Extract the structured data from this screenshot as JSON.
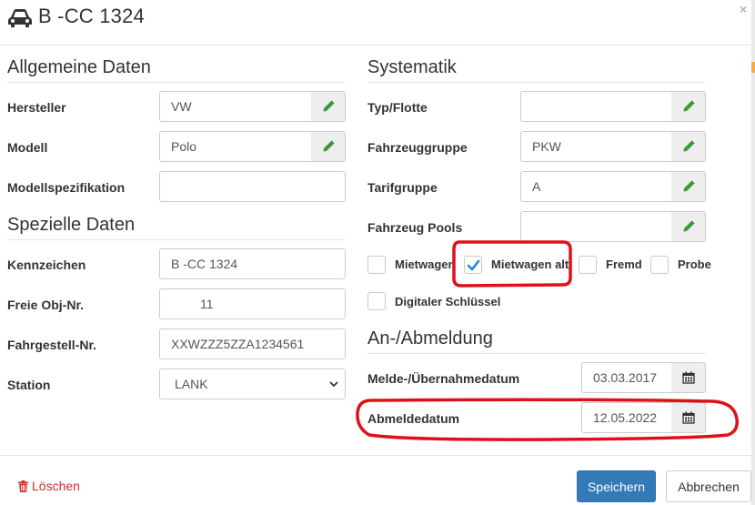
{
  "dialog": {
    "title": "B -CC 1324",
    "close_symbol": "×"
  },
  "general": {
    "title": "Allgemeine Daten",
    "manufacturer": {
      "label": "Hersteller",
      "value": "VW"
    },
    "model": {
      "label": "Modell",
      "value": "Polo"
    },
    "model_spec": {
      "label": "Modellspezifikation",
      "value": ""
    }
  },
  "special": {
    "title": "Spezielle Daten",
    "plate": {
      "label": "Kennzeichen",
      "value": "B  -CC 1324"
    },
    "free_obj": {
      "label": "Freie Obj-Nr.",
      "value": "11"
    },
    "vin": {
      "label": "Fahrgestell-Nr.",
      "value": "XXWZZZ5ZZA1234561"
    },
    "station": {
      "label": "Station",
      "value": "LANK"
    }
  },
  "systematics": {
    "title": "Systematik",
    "type_fleet": {
      "label": "Typ/Flotte",
      "value": ""
    },
    "vehicle_group": {
      "label": "Fahrzeuggruppe",
      "value": "PKW"
    },
    "tariff_group": {
      "label": "Tarifgruppe",
      "value": "A"
    },
    "vehicle_pools": {
      "label": "Fahrzeug Pools",
      "value": ""
    },
    "checkboxes": {
      "mietwagen": {
        "label": "Mietwagen",
        "checked": false
      },
      "mietwagen_alt": {
        "label": "Mietwagen alt",
        "checked": true
      },
      "fremd": {
        "label": "Fremd",
        "checked": false
      },
      "probe": {
        "label": "Probe",
        "checked": false
      },
      "digital_key": {
        "label": "Digitaler Schlüssel",
        "checked": false
      }
    }
  },
  "registration": {
    "title": "An-/Abmeldung",
    "register_date": {
      "label": "Melde-/Übernahmedatum",
      "value": "03.03.2017"
    },
    "deregister_date": {
      "label": "Abmeldedatum",
      "value": "12.05.2022"
    }
  },
  "footer": {
    "delete_label": "Löschen",
    "save_label": "Speichern",
    "cancel_label": "Abbrechen"
  },
  "colors": {
    "primary": "#337ab7",
    "danger": "#c9302c",
    "pencil": "#3c9a3c",
    "check": "#1e88e5",
    "annotation": "#e0101a"
  },
  "icons": {
    "title": "car-icon",
    "edit": "pencil-icon",
    "date": "calendar-icon",
    "delete": "trash-icon",
    "select": "chevron-down-icon"
  }
}
